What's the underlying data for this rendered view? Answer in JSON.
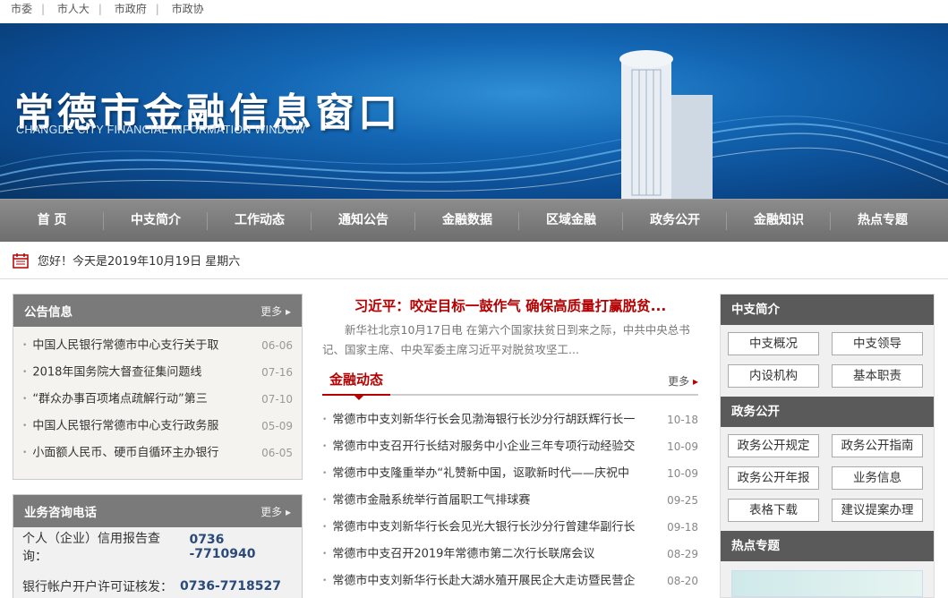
{
  "toplinks": [
    "市委",
    "市人大",
    "市政府",
    "市政协"
  ],
  "banner": {
    "title": "常德市金融信息窗口",
    "subtitle": "CHANGDE CITY FINANCIAL INFORMATION WINDOW"
  },
  "nav": [
    "首 页",
    "中支简介",
    "工作动态",
    "通知公告",
    "金融数据",
    "区域金融",
    "政务公开",
    "金融知识",
    "热点专题"
  ],
  "datebar": {
    "text": "您好！今天是2019年10月19日 星期六"
  },
  "notice": {
    "title": "公告信息",
    "more": "更多",
    "items": [
      {
        "text": "中国人民银行常德市中心支行关于取",
        "date": "06-06"
      },
      {
        "text": "2018年国务院大督查征集问题线",
        "date": "07-16"
      },
      {
        "text": "“群众办事百项堵点疏解行动”第三",
        "date": "07-10"
      },
      {
        "text": "中国人民银行常德市中心支行政务服",
        "date": "05-09"
      },
      {
        "text": "小面额人民币、硬币自循环主办银行",
        "date": "06-05"
      }
    ]
  },
  "consult": {
    "title": "业务咨询电话",
    "more": "更多",
    "rows": [
      {
        "label": "个人（企业）信用报告查询：",
        "num": "0736 -7710940"
      },
      {
        "label": "银行帐户开户许可证核发：",
        "num": "0736-7718527"
      }
    ]
  },
  "headline": {
    "title": "习近平：咬定目标一鼓作气 确保高质量打赢脱贫...",
    "summary": "新华社北京10月17日电 在第六个国家扶贫日到来之际，中共中央总书记、国家主席、中央军委主席习近平对脱贫攻坚工..."
  },
  "finance": {
    "title": "金融动态",
    "more": "更多",
    "items": [
      {
        "text": "常德市中支刘新华行长会见渤海银行长沙分行胡跃辉行长一",
        "date": "10-18"
      },
      {
        "text": "常德市中支召开行长结对服务中小企业三年专项行动经验交",
        "date": "10-09"
      },
      {
        "text": "常德市中支隆重举办“礼赞新中国，讴歌新时代——庆祝中",
        "date": "10-09"
      },
      {
        "text": "常德市金融系统举行首届职工气排球赛",
        "date": "09-25"
      },
      {
        "text": "常德市中支刘新华行长会见光大银行长沙分行曾建华副行长",
        "date": "09-18"
      },
      {
        "text": "常德市中支召开2019年常德市第二次行长联席会议",
        "date": "08-29"
      },
      {
        "text": "常德市中支刘新华行长赴大湖水殖开展民企大走访暨民营企",
        "date": "08-20"
      }
    ]
  },
  "zhongzhi": {
    "title": "中支简介",
    "buttons": [
      "中支概况",
      "中支领导",
      "内设机构",
      "基本职责"
    ]
  },
  "zhengwu": {
    "title": "政务公开",
    "buttons": [
      "政务公开规定",
      "政务公开指南",
      "政务公开年报",
      "业务信息",
      "表格下载",
      "建议提案办理"
    ]
  },
  "hot": {
    "title": "热点专题"
  }
}
